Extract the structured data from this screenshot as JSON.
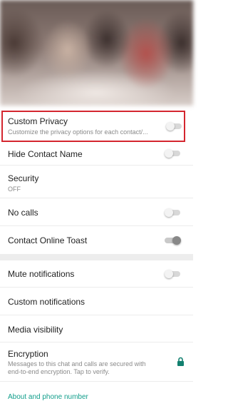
{
  "settings_a": [
    {
      "title": "Custom Privacy",
      "subtitle": "Customize the privacy options for each contact/...",
      "toggle": "off"
    },
    {
      "title": "Hide Contact Name",
      "toggle": "off"
    },
    {
      "title": "Security",
      "subtitle": "OFF"
    },
    {
      "title": "No calls",
      "toggle": "off"
    },
    {
      "title": "Contact Online Toast",
      "toggle": "on"
    }
  ],
  "settings_b": [
    {
      "title": "Mute notifications",
      "toggle": "off"
    },
    {
      "title": "Custom notifications"
    },
    {
      "title": "Media visibility"
    },
    {
      "title": "Encryption",
      "subtitle_line1": "Messages to this chat and calls are secured with",
      "subtitle_line2": "end-to-end encryption. Tap to verify."
    }
  ],
  "footer_link": "About and phone number",
  "colors": {
    "highlight": "#d4262f",
    "accent": "#119e8b",
    "lock": "#12806f"
  }
}
